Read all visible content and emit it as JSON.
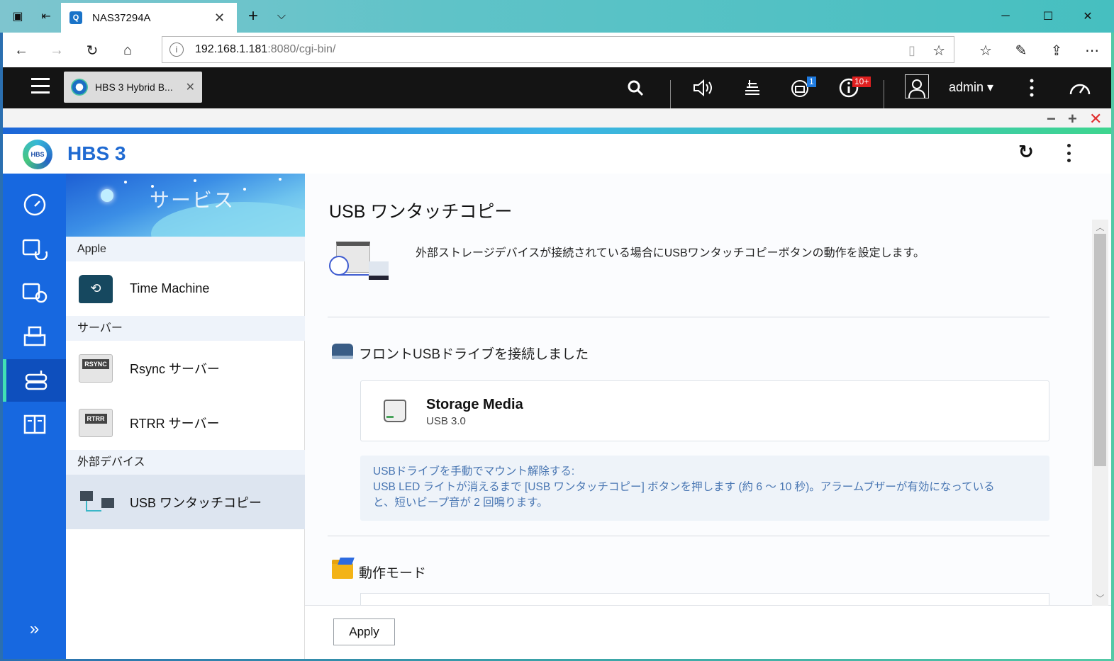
{
  "browser": {
    "tab_title": "NAS37294A",
    "tab_close": "✕",
    "new_tab": "+",
    "tab_list": "⌵",
    "url_host": "192.168.1.181",
    "url_rest": ":8080/cgi-bin/",
    "info_icon": "i",
    "window": {
      "minimize": "─",
      "maximize": "☐",
      "close": "✕"
    }
  },
  "qts": {
    "app_tab_label": "HBS 3 Hybrid B...",
    "app_tab_close": "✕",
    "user_name": "admin ▾",
    "task_badge": "1",
    "notify_badge": "10+",
    "notify_badge_color": "#e02020",
    "task_badge_color": "#1f7be0"
  },
  "app": {
    "title": "HBS 3",
    "logo_text": "HBS",
    "window_tools": {
      "minimize": "−",
      "maximize": "+",
      "close": "✕"
    },
    "accent": "#1f6ad2"
  },
  "sidebar": {
    "banner_title": "サービス",
    "groups": [
      {
        "label": "Apple"
      },
      {
        "label": "サーバー"
      },
      {
        "label": "外部デバイス"
      }
    ],
    "items": [
      {
        "label": "Time Machine",
        "icon": "time-machine-icon"
      },
      {
        "label": "Rsync サーバー",
        "icon": "rsync-icon",
        "badge": "RSYNC"
      },
      {
        "label": "RTRR サーバー",
        "icon": "rtrr-icon",
        "badge": "RTRR"
      },
      {
        "label": "USB ワンタッチコピー",
        "icon": "usb-copy-icon",
        "selected": true
      }
    ],
    "expand": "»"
  },
  "main": {
    "title": "USB ワンタッチコピー",
    "description": "外部ストレージデバイスが接続されている場合にUSBワンタッチコピーボタンの動作を設定します。",
    "front_usb_title": "フロントUSBドライブを接続しました",
    "device": {
      "name": "Storage Media",
      "interface": "USB 3.0"
    },
    "notice": {
      "line1": "USBドライブを手動でマウント解除する:",
      "line2": "USB LED ライトが消えるまで [USB ワンタッチコピー] ボタンを押します (約 6 〜 10 秒)。アラームブザーが有効になっている",
      "line3": "と、短いビープ音が 2 回鳴ります。"
    },
    "mode_title": "動作モード",
    "apply_label": "Apply"
  }
}
